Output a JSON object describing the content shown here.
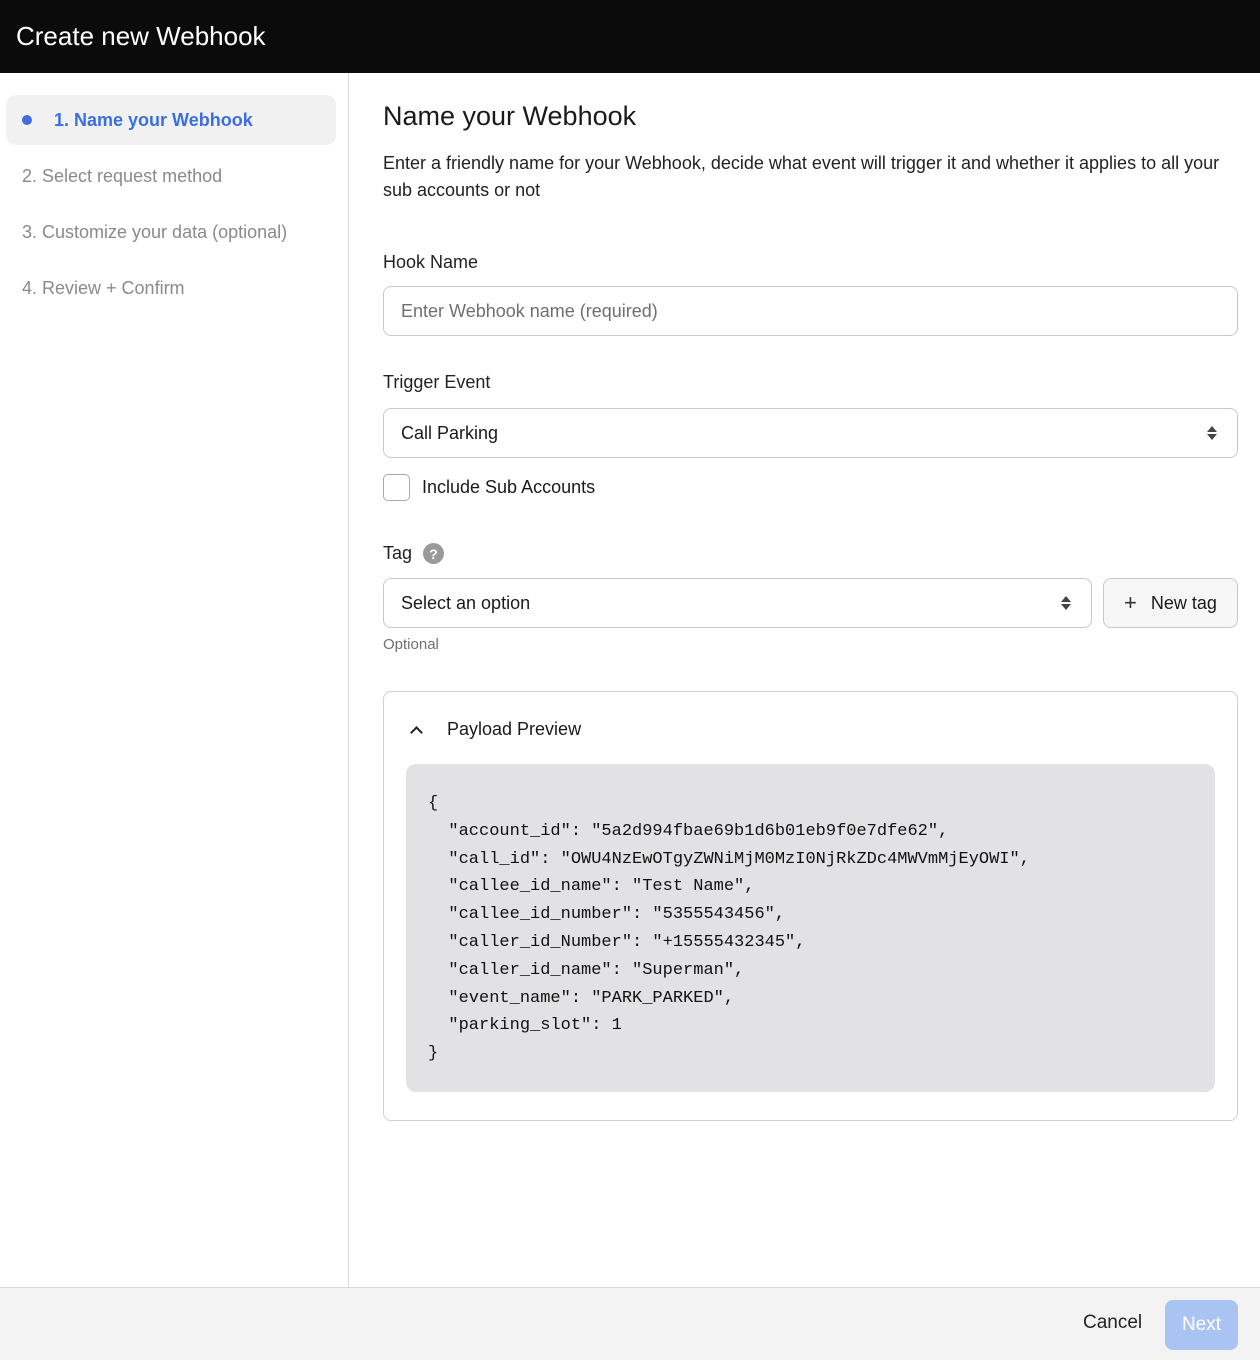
{
  "header": {
    "title": "Create new Webhook"
  },
  "sidebar": {
    "steps": [
      {
        "label": "1. Name your Webhook",
        "active": true
      },
      {
        "label": "2. Select request method",
        "active": false
      },
      {
        "label": "3. Customize your data (optional)",
        "active": false
      },
      {
        "label": "4. Review + Confirm",
        "active": false
      }
    ]
  },
  "main": {
    "title": "Name your Webhook",
    "description": "Enter a friendly name for your Webhook, decide what event will trigger it and whether it applies to all your sub accounts or not",
    "hook_name": {
      "label": "Hook Name",
      "placeholder": "Enter Webhook name (required)",
      "value": ""
    },
    "trigger_event": {
      "label": "Trigger Event",
      "selected": "Call Parking"
    },
    "include_sub_accounts": {
      "label": "Include Sub Accounts",
      "checked": false
    },
    "tag": {
      "label": "Tag",
      "help_icon": "?",
      "selected": "Select an option",
      "new_tag_icon": "+",
      "new_tag_label": "New tag",
      "hint": "Optional"
    },
    "payload_preview": {
      "label": "Payload Preview",
      "expanded": true,
      "code": "{\n  \"account_id\": \"5a2d994fbae69b1d6b01eb9f0e7dfe62\",\n  \"call_id\": \"OWU4NzEwOTgyZWNiMjM0MzI0NjRkZDc4MWVmMjEyOWI\",\n  \"callee_id_name\": \"Test Name\",\n  \"callee_id_number\": \"5355543456\",\n  \"caller_id_Number\": \"+15555432345\",\n  \"caller_id_name\": \"Superman\",\n  \"event_name\": \"PARK_PARKED\",\n  \"parking_slot\": 1\n}"
    }
  },
  "footer": {
    "cancel_label": "Cancel",
    "next_label": "Next",
    "next_enabled": false
  },
  "colors": {
    "accent": "#3b6fe0",
    "header_bg": "#0b0b0b",
    "next_disabled": "#a9c3f2"
  }
}
